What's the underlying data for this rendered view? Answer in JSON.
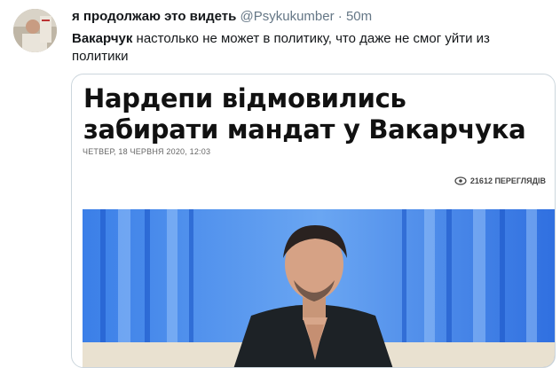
{
  "tweet": {
    "display_name": "я продолжаю это видеть",
    "handle": "@Psykukumber",
    "separator": "·",
    "time": "50m",
    "text_bold": "Вакарчук",
    "text_rest": " настолько не может в политику, что даже не смог уйти из политики"
  },
  "article": {
    "headline": "Нардепи відмовились забирати мандат у Вакарчука",
    "date": "ЧЕТВЕР, 18 ЧЕРВНЯ 2020, 12:03",
    "views": "21612 ПЕРЕГЛЯДІВ",
    "views_icon": "eye-icon"
  },
  "colors": {
    "text": "#14171a",
    "muted": "#657786",
    "card_border": "#ccd6dd",
    "photo_blue": "#2f6fe0"
  }
}
